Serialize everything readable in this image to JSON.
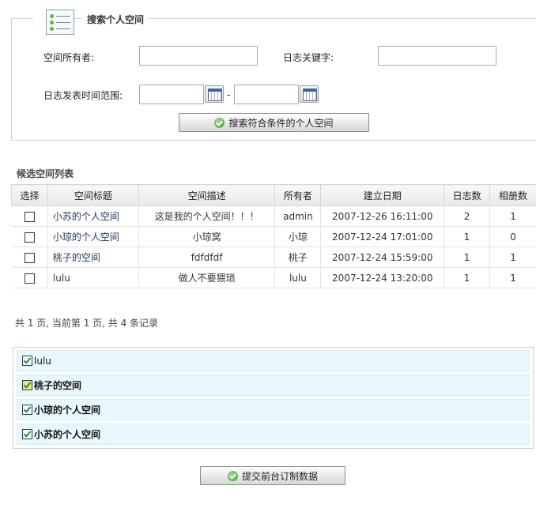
{
  "search": {
    "title": "搜索个人空间",
    "owner_label": "空间所有者:",
    "keyword_label": "日志关键字:",
    "date_range_label": "日志发表时间范围:",
    "date_sep": "-",
    "owner_value": "",
    "keyword_value": "",
    "date_from": "",
    "date_to": "",
    "search_button": "搜索符合条件的个人空间"
  },
  "candidates": {
    "title": "候选空间列表",
    "columns": [
      "选择",
      "空间标题",
      "空间描述",
      "所有者",
      "建立日期",
      "日志数",
      "相册数"
    ],
    "rows": [
      {
        "title": "小苏的个人空间",
        "desc": "这是我的个人空间！！！",
        "owner": "admin",
        "date": "2007-12-26 16:11:00",
        "logs": "2",
        "albums": "1"
      },
      {
        "title": "小琼的个人空间",
        "desc": "小琼窝",
        "owner": "小琼",
        "date": "2007-12-24 17:01:00",
        "logs": "1",
        "albums": "0"
      },
      {
        "title": "桃子的空间",
        "desc": "fdfdfdf",
        "owner": "桃子",
        "date": "2007-12-24 15:59:00",
        "logs": "1",
        "albums": "1"
      },
      {
        "title": "lulu",
        "desc": "做人不要猥琐",
        "owner": "lulu",
        "date": "2007-12-24 13:20:00",
        "logs": "1",
        "albums": "1"
      }
    ]
  },
  "pager": {
    "text": "共 1 页, 当前第 1 页, 共 4 条记录"
  },
  "selected": {
    "items": [
      {
        "label": "lulu",
        "bold": false
      },
      {
        "label": "桃子的空间",
        "bold": true
      },
      {
        "label": "小琼的个人空间",
        "bold": true
      },
      {
        "label": "小苏的个人空间",
        "bold": true
      }
    ]
  },
  "submit_button": "提交前台订制数据"
}
